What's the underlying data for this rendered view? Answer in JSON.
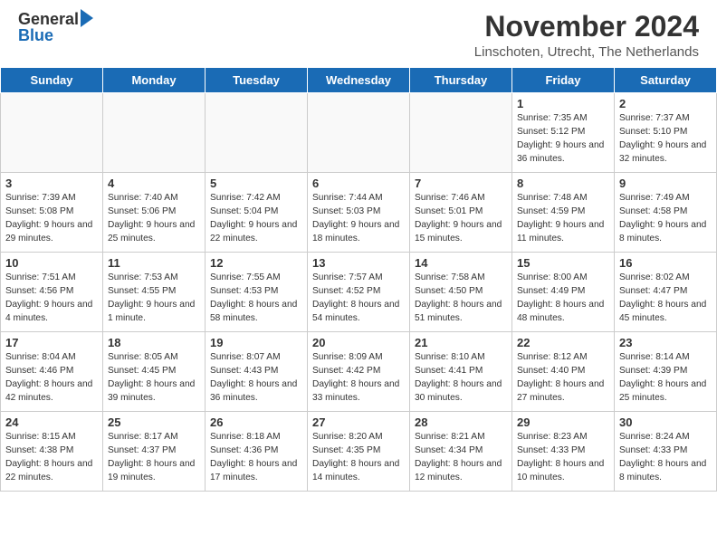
{
  "header": {
    "logo_general": "General",
    "logo_blue": "Blue",
    "month_year": "November 2024",
    "location": "Linschoten, Utrecht, The Netherlands"
  },
  "weekdays": [
    "Sunday",
    "Monday",
    "Tuesday",
    "Wednesday",
    "Thursday",
    "Friday",
    "Saturday"
  ],
  "weeks": [
    [
      {
        "day": "",
        "text": ""
      },
      {
        "day": "",
        "text": ""
      },
      {
        "day": "",
        "text": ""
      },
      {
        "day": "",
        "text": ""
      },
      {
        "day": "",
        "text": ""
      },
      {
        "day": "1",
        "text": "Sunrise: 7:35 AM\nSunset: 5:12 PM\nDaylight: 9 hours and 36 minutes."
      },
      {
        "day": "2",
        "text": "Sunrise: 7:37 AM\nSunset: 5:10 PM\nDaylight: 9 hours and 32 minutes."
      }
    ],
    [
      {
        "day": "3",
        "text": "Sunrise: 7:39 AM\nSunset: 5:08 PM\nDaylight: 9 hours and 29 minutes."
      },
      {
        "day": "4",
        "text": "Sunrise: 7:40 AM\nSunset: 5:06 PM\nDaylight: 9 hours and 25 minutes."
      },
      {
        "day": "5",
        "text": "Sunrise: 7:42 AM\nSunset: 5:04 PM\nDaylight: 9 hours and 22 minutes."
      },
      {
        "day": "6",
        "text": "Sunrise: 7:44 AM\nSunset: 5:03 PM\nDaylight: 9 hours and 18 minutes."
      },
      {
        "day": "7",
        "text": "Sunrise: 7:46 AM\nSunset: 5:01 PM\nDaylight: 9 hours and 15 minutes."
      },
      {
        "day": "8",
        "text": "Sunrise: 7:48 AM\nSunset: 4:59 PM\nDaylight: 9 hours and 11 minutes."
      },
      {
        "day": "9",
        "text": "Sunrise: 7:49 AM\nSunset: 4:58 PM\nDaylight: 9 hours and 8 minutes."
      }
    ],
    [
      {
        "day": "10",
        "text": "Sunrise: 7:51 AM\nSunset: 4:56 PM\nDaylight: 9 hours and 4 minutes."
      },
      {
        "day": "11",
        "text": "Sunrise: 7:53 AM\nSunset: 4:55 PM\nDaylight: 9 hours and 1 minute."
      },
      {
        "day": "12",
        "text": "Sunrise: 7:55 AM\nSunset: 4:53 PM\nDaylight: 8 hours and 58 minutes."
      },
      {
        "day": "13",
        "text": "Sunrise: 7:57 AM\nSunset: 4:52 PM\nDaylight: 8 hours and 54 minutes."
      },
      {
        "day": "14",
        "text": "Sunrise: 7:58 AM\nSunset: 4:50 PM\nDaylight: 8 hours and 51 minutes."
      },
      {
        "day": "15",
        "text": "Sunrise: 8:00 AM\nSunset: 4:49 PM\nDaylight: 8 hours and 48 minutes."
      },
      {
        "day": "16",
        "text": "Sunrise: 8:02 AM\nSunset: 4:47 PM\nDaylight: 8 hours and 45 minutes."
      }
    ],
    [
      {
        "day": "17",
        "text": "Sunrise: 8:04 AM\nSunset: 4:46 PM\nDaylight: 8 hours and 42 minutes."
      },
      {
        "day": "18",
        "text": "Sunrise: 8:05 AM\nSunset: 4:45 PM\nDaylight: 8 hours and 39 minutes."
      },
      {
        "day": "19",
        "text": "Sunrise: 8:07 AM\nSunset: 4:43 PM\nDaylight: 8 hours and 36 minutes."
      },
      {
        "day": "20",
        "text": "Sunrise: 8:09 AM\nSunset: 4:42 PM\nDaylight: 8 hours and 33 minutes."
      },
      {
        "day": "21",
        "text": "Sunrise: 8:10 AM\nSunset: 4:41 PM\nDaylight: 8 hours and 30 minutes."
      },
      {
        "day": "22",
        "text": "Sunrise: 8:12 AM\nSunset: 4:40 PM\nDaylight: 8 hours and 27 minutes."
      },
      {
        "day": "23",
        "text": "Sunrise: 8:14 AM\nSunset: 4:39 PM\nDaylight: 8 hours and 25 minutes."
      }
    ],
    [
      {
        "day": "24",
        "text": "Sunrise: 8:15 AM\nSunset: 4:38 PM\nDaylight: 8 hours and 22 minutes."
      },
      {
        "day": "25",
        "text": "Sunrise: 8:17 AM\nSunset: 4:37 PM\nDaylight: 8 hours and 19 minutes."
      },
      {
        "day": "26",
        "text": "Sunrise: 8:18 AM\nSunset: 4:36 PM\nDaylight: 8 hours and 17 minutes."
      },
      {
        "day": "27",
        "text": "Sunrise: 8:20 AM\nSunset: 4:35 PM\nDaylight: 8 hours and 14 minutes."
      },
      {
        "day": "28",
        "text": "Sunrise: 8:21 AM\nSunset: 4:34 PM\nDaylight: 8 hours and 12 minutes."
      },
      {
        "day": "29",
        "text": "Sunrise: 8:23 AM\nSunset: 4:33 PM\nDaylight: 8 hours and 10 minutes."
      },
      {
        "day": "30",
        "text": "Sunrise: 8:24 AM\nSunset: 4:33 PM\nDaylight: 8 hours and 8 minutes."
      }
    ]
  ]
}
